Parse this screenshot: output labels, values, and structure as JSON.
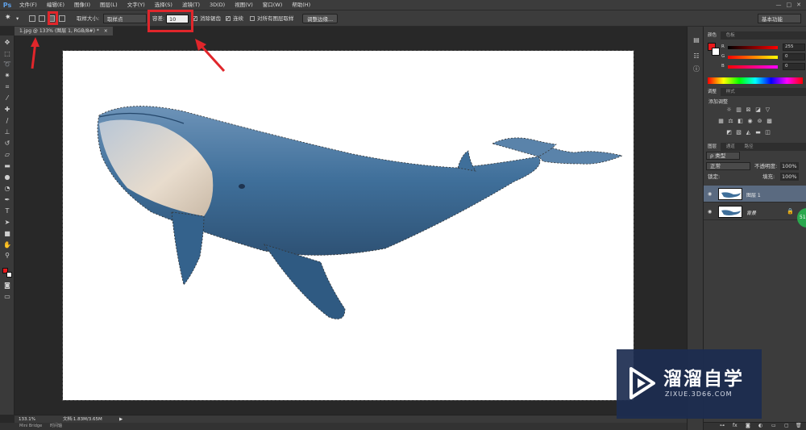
{
  "app": {
    "logo_text": "Ps"
  },
  "menu": [
    "文件(F)",
    "编辑(E)",
    "图像(I)",
    "图层(L)",
    "文字(Y)",
    "选择(S)",
    "滤镜(T)",
    "3D(D)",
    "视图(V)",
    "窗口(W)",
    "帮助(H)"
  ],
  "window_controls": [
    "—",
    "□",
    "✕"
  ],
  "options": {
    "sample_size_label": "取样大小:",
    "sample_size_value": "取样点",
    "tolerance_label": "容差:",
    "tolerance_value": "10",
    "antialias_label": "消除锯齿",
    "contiguous_label": "连续",
    "all_layers_label": "对所有图层取样",
    "refine_edge_label": "调整边缘...",
    "workspace_value": "基本功能"
  },
  "document_tab": {
    "label": "1.jpg @ 133% (图层 1, RGB/8#) *",
    "close": "×"
  },
  "status": {
    "zoom": "133.1%",
    "doc_info": "文档:1.83M/3.65M"
  },
  "mini_bridge": {
    "tabs": [
      "Mini Bridge",
      "时间轴"
    ]
  },
  "color_panel": {
    "tabs": [
      "颜色",
      "色板"
    ],
    "r_label": "R",
    "r_value": "255",
    "g_label": "G",
    "g_value": "0",
    "b_label": "B",
    "b_value": "0",
    "foreground": "#e8191b",
    "background": "#ffffff"
  },
  "adjustments_panel": {
    "tabs": [
      "调整",
      "样式"
    ],
    "title": "添加调整"
  },
  "layers_panel": {
    "tabs": [
      "图层",
      "通道",
      "路径"
    ],
    "filter_label": "ρ 类型",
    "blend_mode": "正常",
    "opacity_label": "不透明度:",
    "opacity_value": "100%",
    "lock_label": "锁定:",
    "fill_label": "填充:",
    "fill_value": "100%",
    "layers": [
      {
        "name": "图层 1",
        "selected": true
      },
      {
        "name": "背景",
        "selected": false
      }
    ]
  },
  "watermark": {
    "text_cn": "溜溜自学",
    "text_en": "ZIXUE.3D66.COM"
  },
  "side_badge": "51",
  "colors": {
    "annotation_red": "#e0262b",
    "selection_blue": "#5a6a80",
    "whale_blue": "#3f6f9a"
  }
}
